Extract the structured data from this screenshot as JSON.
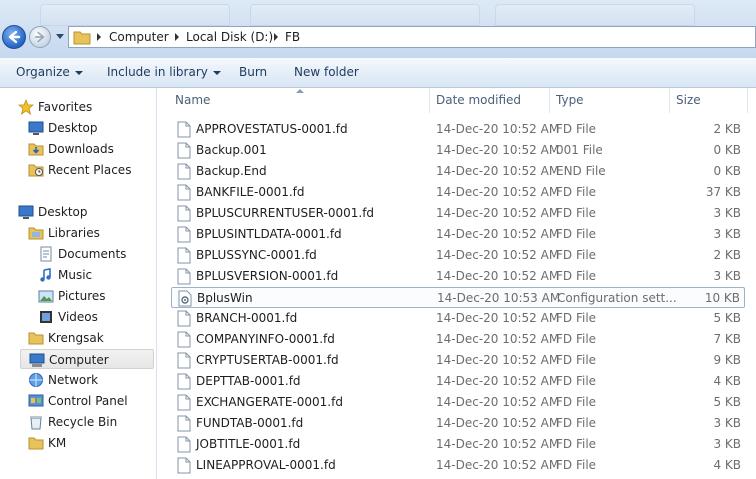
{
  "address": {
    "crumbs": [
      "Computer",
      "Local Disk (D:)",
      "FB"
    ]
  },
  "toolbar": {
    "organize": "Organize",
    "include_in_library": "Include in library",
    "burn": "Burn",
    "new_folder": "New folder"
  },
  "nav": {
    "favorites": "Favorites",
    "desktop_fav": "Desktop",
    "downloads": "Downloads",
    "recent_places": "Recent Places",
    "desktop": "Desktop",
    "libraries": "Libraries",
    "documents": "Documents",
    "music": "Music",
    "pictures": "Pictures",
    "videos": "Videos",
    "krengsak": "Krengsak",
    "computer": "Computer",
    "network": "Network",
    "control_panel": "Control Panel",
    "recycle_bin": "Recycle Bin",
    "km": "KM"
  },
  "columns": {
    "name": "Name",
    "date": "Date modified",
    "type": "Type",
    "size": "Size"
  },
  "files": [
    {
      "name": "APPROVESTATUS-0001.fd",
      "date": "14-Dec-20 10:52 AM",
      "type": "FD File",
      "size": "2 KB"
    },
    {
      "name": "Backup.001",
      "date": "14-Dec-20 10:52 AM",
      "type": "001 File",
      "size": "0 KB"
    },
    {
      "name": "Backup.End",
      "date": "14-Dec-20 10:52 AM",
      "type": "END File",
      "size": "0 KB"
    },
    {
      "name": "BANKFILE-0001.fd",
      "date": "14-Dec-20 10:52 AM",
      "type": "FD File",
      "size": "37 KB"
    },
    {
      "name": "BPLUSCURRENTUSER-0001.fd",
      "date": "14-Dec-20 10:52 AM",
      "type": "FD File",
      "size": "3 KB"
    },
    {
      "name": "BPLUSINTLDATA-0001.fd",
      "date": "14-Dec-20 10:52 AM",
      "type": "FD File",
      "size": "3 KB"
    },
    {
      "name": "BPLUSSYNC-0001.fd",
      "date": "14-Dec-20 10:52 AM",
      "type": "FD File",
      "size": "2 KB"
    },
    {
      "name": "BPLUSVERSION-0001.fd",
      "date": "14-Dec-20 10:52 AM",
      "type": "FD File",
      "size": "3 KB"
    },
    {
      "name": "BplusWin",
      "date": "14-Dec-20 10:53 AM",
      "type": "Configuration sett...",
      "size": "10 KB"
    },
    {
      "name": "BRANCH-0001.fd",
      "date": "14-Dec-20 10:52 AM",
      "type": "FD File",
      "size": "5 KB"
    },
    {
      "name": "COMPANYINFO-0001.fd",
      "date": "14-Dec-20 10:52 AM",
      "type": "FD File",
      "size": "7 KB"
    },
    {
      "name": "CRYPTUSERTAB-0001.fd",
      "date": "14-Dec-20 10:52 AM",
      "type": "FD File",
      "size": "9 KB"
    },
    {
      "name": "DEPTTAB-0001.fd",
      "date": "14-Dec-20 10:52 AM",
      "type": "FD File",
      "size": "4 KB"
    },
    {
      "name": "EXCHANGERATE-0001.fd",
      "date": "14-Dec-20 10:52 AM",
      "type": "FD File",
      "size": "5 KB"
    },
    {
      "name": "FUNDTAB-0001.fd",
      "date": "14-Dec-20 10:52 AM",
      "type": "FD File",
      "size": "3 KB"
    },
    {
      "name": "JOBTITLE-0001.fd",
      "date": "14-Dec-20 10:52 AM",
      "type": "FD File",
      "size": "3 KB"
    },
    {
      "name": "LINEAPPROVAL-0001.fd",
      "date": "14-Dec-20 10:52 AM",
      "type": "FD File",
      "size": "4 KB"
    }
  ],
  "colors": {
    "accent": "#1e3a5f",
    "row_highlight_border": "#9db3cc",
    "folder": "#e8c25a"
  }
}
